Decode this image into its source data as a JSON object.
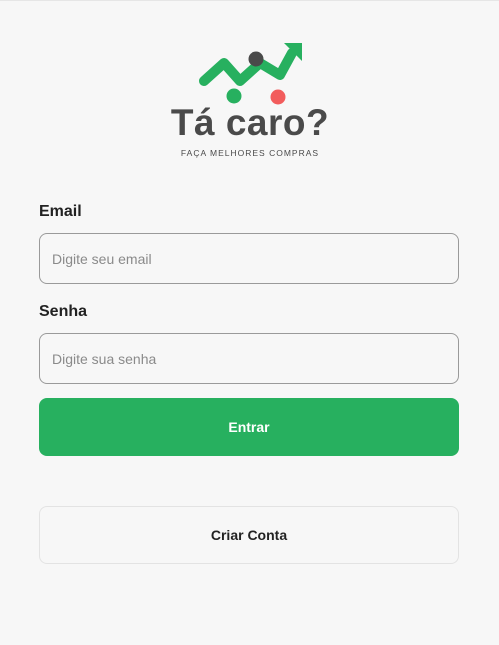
{
  "brand": {
    "name": "Tá caro?",
    "tagline": "FAÇA MELHORES COMPRAS",
    "colors": {
      "primary": "#27b05f",
      "dark": "#4a4a4a",
      "accent": "#f25c5c"
    }
  },
  "form": {
    "email": {
      "label": "Email",
      "placeholder": "Digite seu email",
      "value": ""
    },
    "password": {
      "label": "Senha",
      "placeholder": "Digite sua senha",
      "value": ""
    },
    "submit_label": "Entrar",
    "create_account_label": "Criar Conta"
  }
}
